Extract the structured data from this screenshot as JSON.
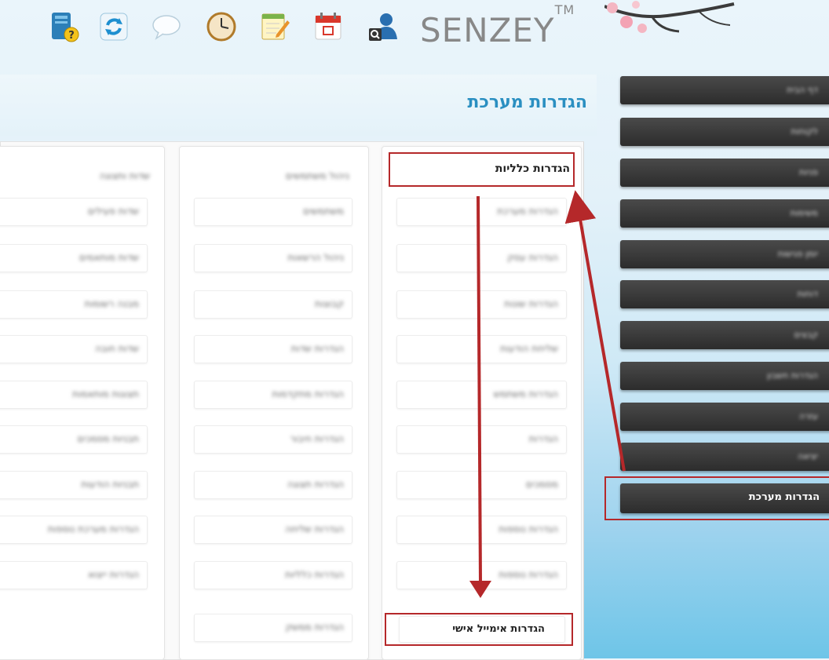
{
  "brand": {
    "name": "SENZEY",
    "tm": "TM"
  },
  "toolbar": {
    "icons": [
      "help-book-icon",
      "refresh-icon",
      "chat-bubble-icon",
      "clock-icon",
      "notepad-icon",
      "calendar-icon",
      "user-search-icon"
    ]
  },
  "page": {
    "title": "הגדרות מערכת"
  },
  "columns": [
    {
      "header": "הגדרות כלליות",
      "items": [
        "הגדרות כלליות",
        "הגדרות מערכת",
        "הגדרות עסק",
        "הגדרות שונות",
        "שליחת הודעות",
        "הגדרות משתמש",
        "הגדרות",
        "מסמכים",
        "הגדרות נוספות",
        "הגדרות אימייל אישי"
      ]
    },
    {
      "header": "ניהול משתמשים",
      "items": [
        "משתמשים",
        "ניהול הרשאות",
        "קבוצות",
        "הגדרות שדות",
        "הגדרות מתקדמות",
        "הגדרות חיבור",
        "הגדרות תצוגה",
        "הגדרות שליחה",
        "הגדרות כלליות",
        "הגדרות ממשק"
      ]
    },
    {
      "header": "שדות ותצוגה",
      "items": [
        "שדות פעילים",
        "שדות מותאמים",
        "מבנה רשומות",
        "שדות חובה",
        "תצוגות מותאמות",
        "תבניות מסמכים",
        "תבניות הודעות",
        "הגדרות מערכת נוספות",
        "הגדרות ייצוא"
      ]
    }
  ],
  "sidebar": {
    "items": [
      "דף הבית",
      "לקוחות",
      "פניות",
      "משימות",
      "יומן פגישות",
      "דוחות",
      "קבצים",
      "הגדרות חשבון",
      "עזרה",
      "יציאה",
      "הגדרות מערכת"
    ],
    "active_index": 10
  },
  "labels": {
    "general_settings": "הגדרות כלליות",
    "personal_email_settings": "הגדרות אימייל אישי",
    "system_settings": "הגדרות מערכת"
  },
  "colors": {
    "accent_title": "#2a8fc1",
    "highlight": "#b5282a"
  }
}
